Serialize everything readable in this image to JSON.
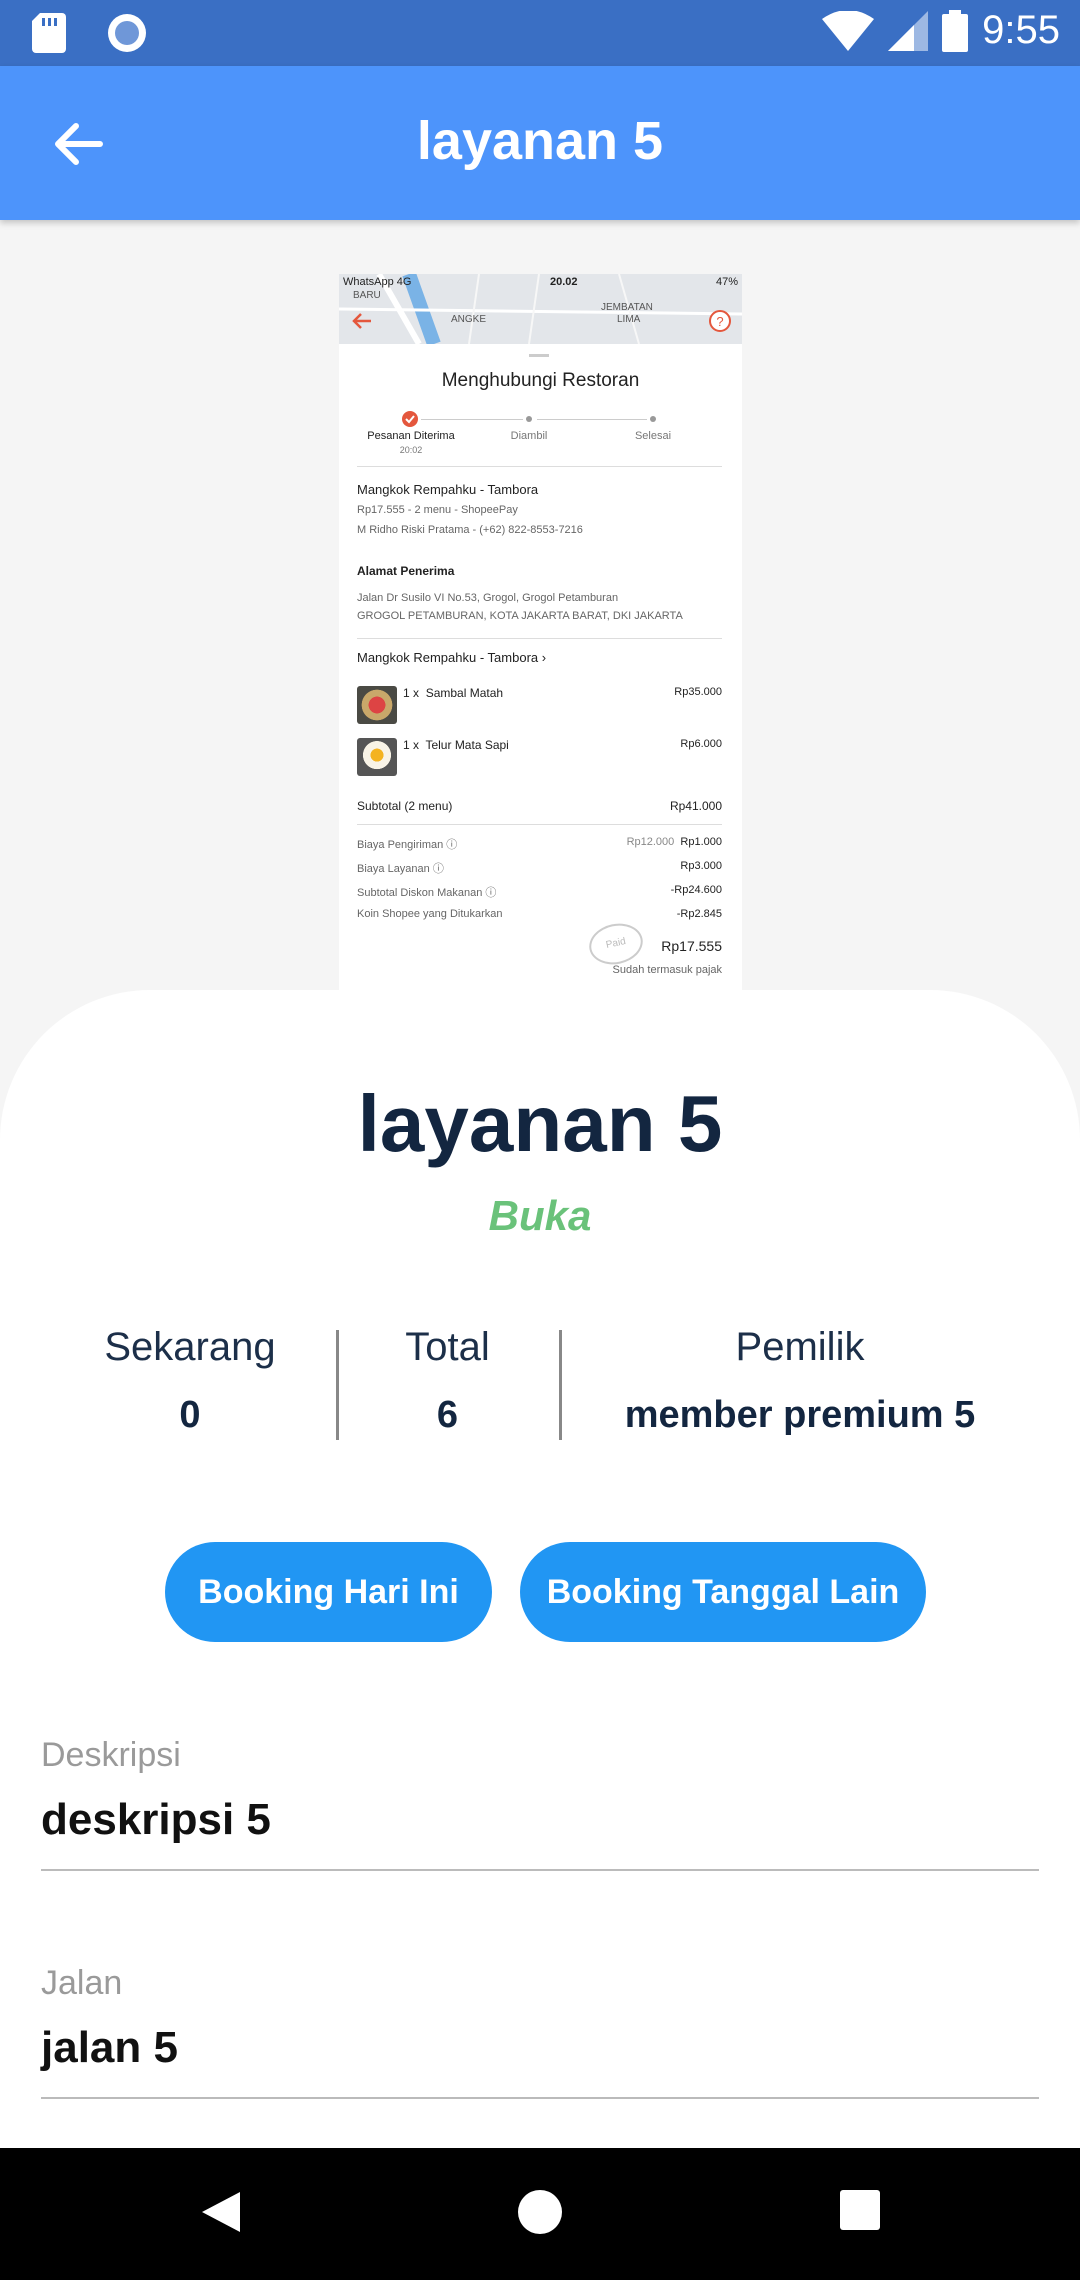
{
  "status_bar": {
    "time": "9:55",
    "icons": [
      "sd-card-icon",
      "record-icon",
      "wifi-icon",
      "signal-icon",
      "battery-icon"
    ]
  },
  "app_bar": {
    "title": "layanan 5",
    "back_icon": "arrow-left-icon"
  },
  "receipt": {
    "status_left": "WhatsApp 4G",
    "status_time": "20.02",
    "status_battery": "47%",
    "map_labels": [
      "BARU",
      "ANGKE",
      "JEMBATAN",
      "LIMA"
    ],
    "heading": "Menghubungi Restoran",
    "steps": [
      {
        "label": "Pesanan Diterima",
        "time": "20:02"
      },
      {
        "label": "Diambil",
        "time": ""
      },
      {
        "label": "Selesai",
        "time": ""
      }
    ],
    "restaurant": "Mangkok Rempahku - Tambora",
    "order_summary": "Rp17.555 - 2 menu - ShopeePay",
    "customer": "M Ridho Riski Pratama - (+62) 822-8553-7216",
    "address_title": "Alamat Penerima",
    "address_line1": "Jalan Dr Susilo VI No.53, Grogol, Grogol Petamburan",
    "address_line2": "GROGOL PETAMBURAN, KOTA JAKARTA BARAT, DKI JAKARTA",
    "restaurant_link": "Mangkok Rempahku - Tambora",
    "items": [
      {
        "qty": "1 x",
        "name": "Sambal Matah",
        "price": "Rp35.000"
      },
      {
        "qty": "1 x",
        "name": "Telur Mata Sapi",
        "price": "Rp6.000"
      }
    ],
    "subtotal_label": "Subtotal (2 menu)",
    "subtotal_value": "Rp41.000",
    "fees": [
      {
        "label": "Biaya Pengiriman",
        "old": "Rp12.000",
        "value": "Rp1.000"
      },
      {
        "label": "Biaya Layanan",
        "old": "",
        "value": "Rp3.000"
      },
      {
        "label": "Subtotal Diskon Makanan",
        "old": "",
        "value": "-Rp24.600"
      },
      {
        "label": "Koin Shopee yang Ditukarkan",
        "old": "",
        "value": "-Rp2.845"
      }
    ],
    "total": "Rp17.555",
    "total_note": "Sudah termasuk pajak",
    "stamp": "Paid"
  },
  "service": {
    "name": "layanan 5",
    "status": "Buka"
  },
  "stats": [
    {
      "label": "Sekarang",
      "value": "0"
    },
    {
      "label": "Total",
      "value": "6"
    },
    {
      "label": "Pemilik",
      "value": "member premium 5"
    }
  ],
  "buttons": {
    "book_today": "Booking Hari Ini",
    "book_other": "Booking Tanggal Lain"
  },
  "fields": [
    {
      "label": "Deskripsi",
      "value": "deskripsi 5"
    },
    {
      "label": "Jalan",
      "value": "jalan 5"
    }
  ],
  "colors": {
    "status_bar": "#3a6fc4",
    "app_bar": "#4d94fb",
    "button": "#2196f3",
    "open_status": "#6ac27a",
    "title_text": "#132640"
  }
}
